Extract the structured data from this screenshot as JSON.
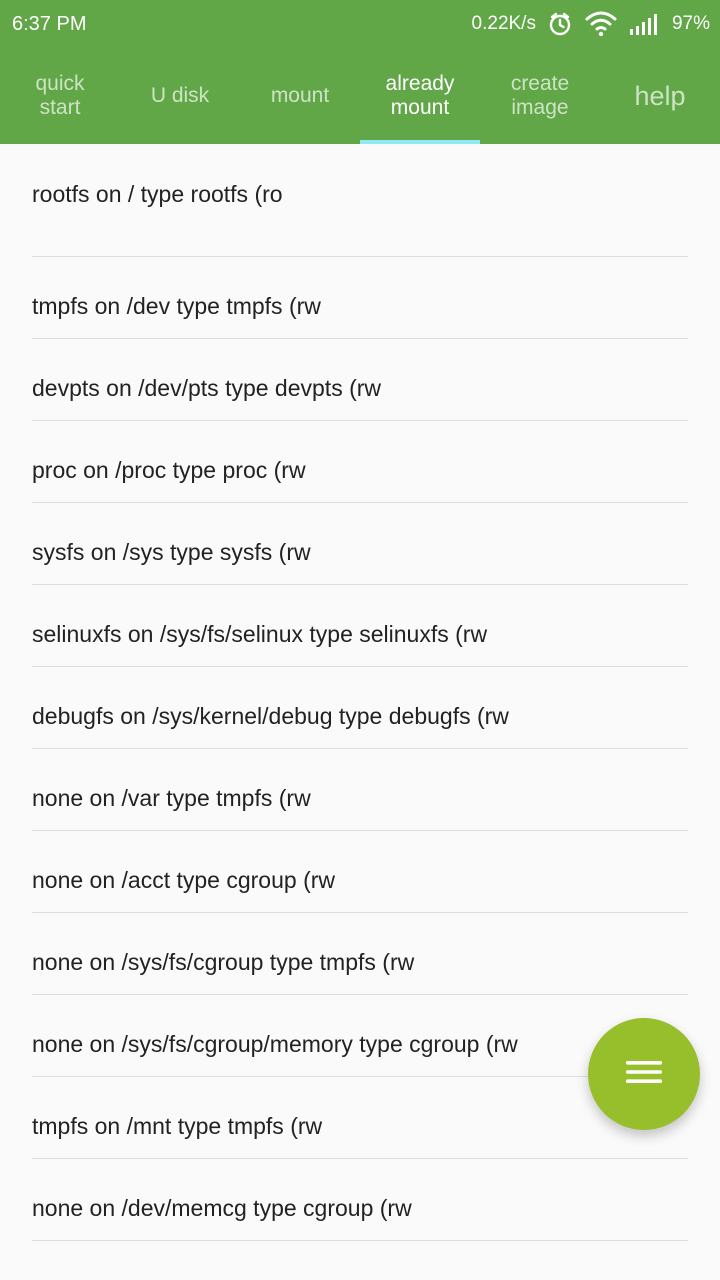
{
  "status_bar": {
    "time": "6:37 PM",
    "network_speed": "0.22K/s",
    "battery": "97%",
    "icons": [
      "alarm-icon",
      "wifi-icon",
      "signal-icon"
    ]
  },
  "tabs": [
    {
      "label": "quick\nstart",
      "active": false
    },
    {
      "label": "U disk",
      "active": false
    },
    {
      "label": "mount",
      "active": false
    },
    {
      "label": "already\nmount",
      "active": true
    },
    {
      "label": "create\nimage",
      "active": false
    },
    {
      "label": "help",
      "active": false
    }
  ],
  "mount_list": [
    "rootfs on / type rootfs (ro",
    "tmpfs on /dev type tmpfs (rw",
    "devpts on /dev/pts type devpts (rw",
    "proc on /proc type proc (rw",
    "sysfs on /sys type sysfs (rw",
    "selinuxfs on /sys/fs/selinux type selinuxfs (rw",
    "debugfs on /sys/kernel/debug type debugfs (rw",
    "none on /var type tmpfs (rw",
    "none on /acct type cgroup (rw",
    "none on /sys/fs/cgroup type tmpfs (rw",
    "none on /sys/fs/cgroup/memory type cgroup (rw",
    "tmpfs on /mnt type tmpfs (rw",
    "none on /dev/memcg type cgroup (rw"
  ],
  "fab": {
    "icon": "menu-icon"
  },
  "colors": {
    "toolbar": "#61a748",
    "tab_indicator": "#8fe9f0",
    "fab": "#97bf2b",
    "background": "#fafafa"
  }
}
